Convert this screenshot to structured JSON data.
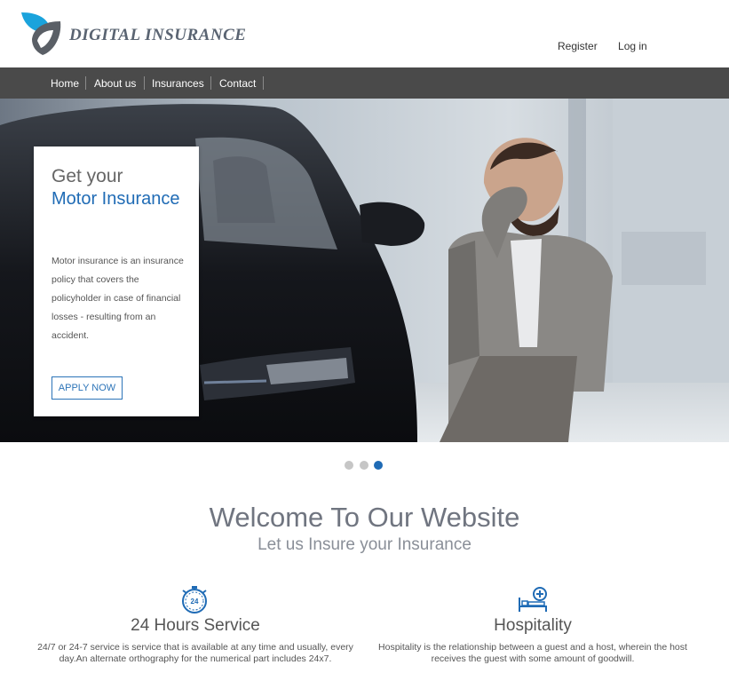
{
  "brand": {
    "name": "DIGITAL INSURANCE"
  },
  "top_links": {
    "register": "Register",
    "login": "Log in"
  },
  "nav": {
    "items": [
      "Home",
      "About us",
      "Insurances",
      "Contact"
    ]
  },
  "hero": {
    "title_line1": "Get your",
    "title_line2": "Motor Insurance",
    "description": "Motor insurance is an insurance policy that covers the policyholder in case of financial losses - resulting from an accident.",
    "cta": "APPLY NOW"
  },
  "carousel": {
    "slide_count": 3,
    "active_index": 2
  },
  "welcome": {
    "title": "Welcome To Our Website",
    "subtitle": "Let us Insure your Insurance"
  },
  "services": [
    {
      "icon": "stopwatch-24-icon",
      "title": "24 Hours Service",
      "description": "24/7 or 24-7 service is service that is available at any time and usually, every day.An alternate orthography for the numerical part includes 24x7."
    },
    {
      "icon": "hospital-bed-icon",
      "title": "Hospitality",
      "description": "Hospitality is the relationship between a guest and a host, wherein the host receives the guest with some amount of goodwill."
    }
  ],
  "colors": {
    "accent": "#1f6bb5",
    "nav_bg": "#4a4a4a",
    "logo_blue": "#1aa3dc",
    "logo_gray": "#5a5f66"
  }
}
